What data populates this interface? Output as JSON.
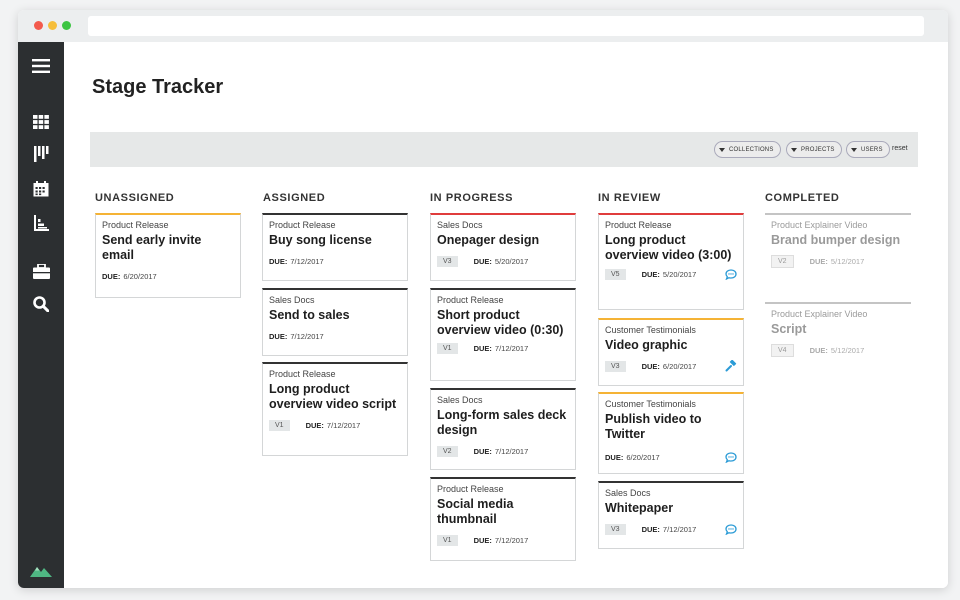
{
  "app": {
    "title": "Stage Tracker"
  },
  "filters": {
    "collections": "COLLECTIONS",
    "projects": "PROJECTS",
    "users": "USERS",
    "reset": "reset"
  },
  "columns": [
    {
      "title": "UNASSIGNED"
    },
    {
      "title": "ASSIGNED"
    },
    {
      "title": "IN PROGRESS"
    },
    {
      "title": "IN REVIEW"
    },
    {
      "title": "COMPLETED"
    }
  ],
  "cards": {
    "c0": {
      "category": "Product Release",
      "title": "Send early invite email",
      "due_label": "DUE:",
      "due": "6/20/2017",
      "accent": "#f5b335"
    },
    "c1": {
      "category": "Product Release",
      "title": "Buy song license",
      "due_label": "DUE:",
      "due": "7/12/2017",
      "accent": "#333333"
    },
    "c2": {
      "category": "Sales Docs",
      "title": "Send to sales",
      "due_label": "DUE:",
      "due": "7/12/2017",
      "accent": "#333333"
    },
    "c3": {
      "category": "Product Release",
      "title": "Long product overview video script",
      "version": "V1",
      "due_label": "DUE:",
      "due": "7/12/2017",
      "accent": "#333333"
    },
    "c4": {
      "category": "Sales Docs",
      "title": "Onepager design",
      "version": "V3",
      "due_label": "DUE:",
      "due": "5/20/2017",
      "accent": "#e03c3c"
    },
    "c5": {
      "category": "Product Release",
      "title": "Short product overview video (0:30)",
      "version": "V1",
      "due_label": "DUE:",
      "due": "7/12/2017",
      "accent": "#333333"
    },
    "c6": {
      "category": "Sales Docs",
      "title": "Long-form sales deck design",
      "version": "V2",
      "due_label": "DUE:",
      "due": "7/12/2017",
      "accent": "#333333"
    },
    "c7": {
      "category": "Product Release",
      "title": "Social media thumbnail",
      "version": "V1",
      "due_label": "DUE:",
      "due": "7/12/2017",
      "accent": "#333333"
    },
    "c8": {
      "category": "Product Release",
      "title": "Long product overview video (3:00)",
      "version": "V5",
      "due_label": "DUE:",
      "due": "5/20/2017",
      "accent": "#e03c3c",
      "icon": "comment-icon"
    },
    "c9": {
      "category": "Customer Testimonials",
      "title": "Video graphic",
      "version": "V3",
      "due_label": "DUE:",
      "due": "6/20/2017",
      "accent": "#f5b335",
      "icon": "gavel-icon"
    },
    "c10": {
      "category": "Customer Testimonials",
      "title": "Publish video to Twitter",
      "due_label": "DUE:",
      "due": "6/20/2017",
      "accent": "#f5b335",
      "icon": "comment-icon"
    },
    "c11": {
      "category": "Sales Docs",
      "title": "Whitepaper",
      "version": "V3",
      "due_label": "DUE:",
      "due": "7/12/2017",
      "accent": "#333333",
      "icon": "comment-icon"
    },
    "c12": {
      "category": "Product Explainer Video",
      "title": "Brand bumper design",
      "version": "V2",
      "due_label": "DUE:",
      "due": "5/12/2017"
    },
    "c13": {
      "category": "Product Explainer Video",
      "title": "Script",
      "version": "V4",
      "due_label": "DUE:",
      "due": "5/12/2017"
    }
  },
  "colors": {
    "sidebar": "#2c2f31",
    "accent_red": "#e03c3c",
    "accent_yellow": "#f5b335",
    "icon_blue": "#2b9bd6",
    "logo_green": "#4fb783"
  }
}
